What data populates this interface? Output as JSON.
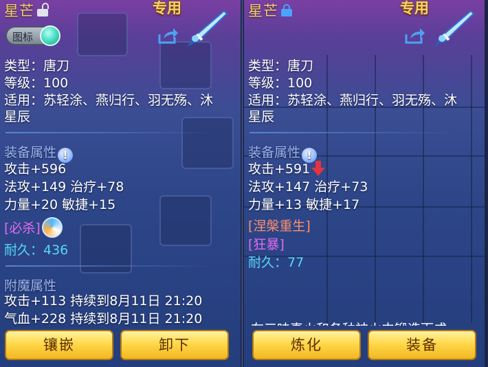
{
  "left_panel": {
    "name": "星芒",
    "exclusive_label": "专用",
    "icon_toggle_label": "图标",
    "type_line": "类型：唐刀",
    "level_line": "等级：100",
    "applicable_line1": "适用：苏轻涂、燕归行、羽无殇、沐",
    "applicable_line2": "星辰",
    "attr_title": "装备属性",
    "attr_attack": "攻击+596",
    "attr_magic_heal": "法攻+149 治疗+78",
    "attr_str_agi": "力量+20 敏捷+15",
    "skill_1": "[必杀]",
    "durability": "耐久：436",
    "enchant_title": "附魔属性",
    "enchant_1": "攻击+113 持续到8月11日 21:20",
    "enchant_2": "气血+228 持续到8月11日 21:20",
    "button_inlay": "镶嵌",
    "button_unequip": "卸下"
  },
  "right_panel": {
    "name": "星芒",
    "exclusive_label": "专用",
    "type_line": "类型：唐刀",
    "level_line": "等级：100",
    "applicable_line1": "适用：苏轻涂、燕归行、羽无殇、沐",
    "applicable_line2": "星辰",
    "attr_title": "装备属性",
    "attr_attack": "攻击+591",
    "attr_magic_heal": "法攻+147 治疗+73",
    "attr_str_agi": "力量+13 敏捷+17",
    "skill_1": "[涅槃重生]",
    "skill_2": "[狂暴]",
    "durability": "耐久：77",
    "cut_text": "在三味真火和各种神火中锻造而成",
    "button_refine": "炼化",
    "button_equip": "装备"
  },
  "colors": {
    "name": "#f3cf68",
    "section": "#9bb4f2",
    "skill_magenta": "#e46af0",
    "skill_salmon": "#ff8f6b",
    "durability": "#55d8f6",
    "down_arrow": "#e2353f",
    "button": "#ffd84a"
  },
  "icons": [
    "unlock-icon",
    "lock-icon",
    "share-icon",
    "weapon-icon",
    "info-icon",
    "down-arrow-icon",
    "skill-swirl-icon",
    "toggle-knob"
  ]
}
